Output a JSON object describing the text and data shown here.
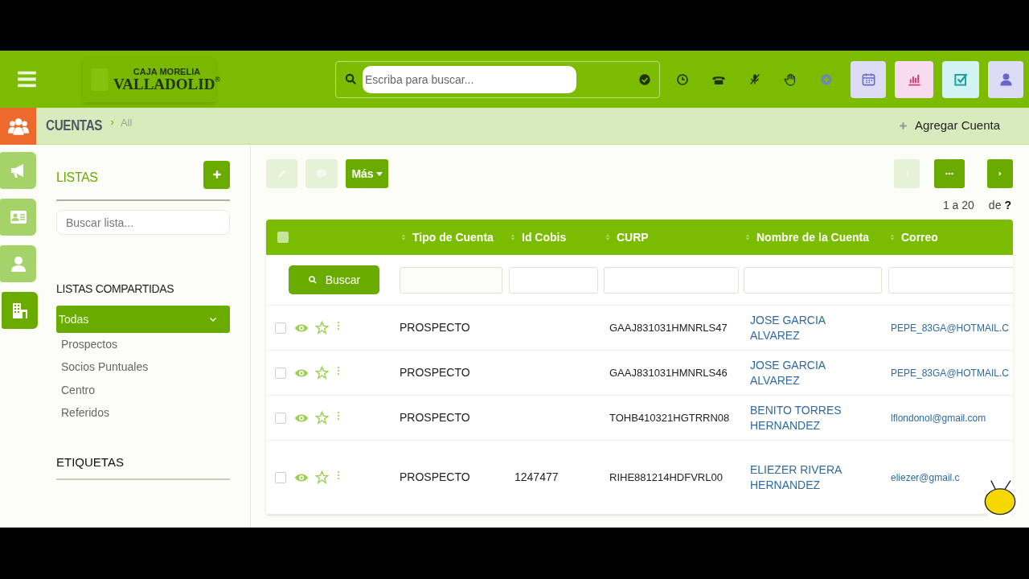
{
  "header": {
    "logo": {
      "line1": "CAJA MORELIA",
      "line2": "VALLADOLID",
      "mark": "®"
    },
    "search": {
      "placeholder": "Escriba para buscar..."
    }
  },
  "page_bar": {
    "title": "CUENTAS",
    "crumb_separator": "›",
    "crumb": "All",
    "add_button": "Agregar Cuenta"
  },
  "rail": [
    {
      "kind": "megaphone",
      "selected": false
    },
    {
      "kind": "card",
      "selected": false
    },
    {
      "kind": "person",
      "selected": false
    },
    {
      "kind": "building",
      "selected": true
    }
  ],
  "sidebar": {
    "lists_title": "LISTAS",
    "search_placeholder": "Buscar lista...",
    "shared_title": "LISTAS COMPARTIDAS",
    "shared_items": [
      {
        "label": "Todas",
        "selected": true
      },
      {
        "label": "Prospectos",
        "selected": false
      },
      {
        "label": "Socios Puntuales",
        "selected": false
      },
      {
        "label": "Centro",
        "selected": false
      },
      {
        "label": "Referidos",
        "selected": false
      }
    ],
    "tags_title": "ETIQUETAS"
  },
  "toolbar": {
    "more_button": "Más",
    "range": "1 a 20",
    "of": "de",
    "total": "?"
  },
  "table": {
    "columns": [
      "Tipo de Cuenta",
      "Id Cobis",
      "CURP",
      "Nombre de la Cuenta",
      "Correo"
    ],
    "search_button": "Buscar",
    "select_all_checked": false,
    "rows": [
      {
        "checked": false,
        "tipo": "PROSPECTO",
        "curp": "GAAJ831031HMNRLS47",
        "nombre": "JOSE GARCIA ALVAREZ",
        "correo": "PEPE_83GA@HOTMAIL.C"
      },
      {
        "checked": false,
        "tipo": "PROSPECTO",
        "curp": "GAAJ831031HMNRLS46",
        "nombre": "JOSE GARCIA ALVAREZ",
        "correo": "PEPE_83GA@HOTMAIL.C"
      },
      {
        "checked": false,
        "tipo": "PROSPECTO",
        "curp": "TOHB410321HGTRRN08",
        "nombre": "BENITO TORRES HERNANDEZ",
        "correo": "lflondonol@gmail.com"
      },
      {
        "checked": false,
        "tipo": "PROSPECTO",
        "id_cobis": "1247477",
        "curp": "RIHE881214HDFVRL00",
        "nombre": "ELIEZER RIVERA HERNANDEZ",
        "correo": "eliezer@gmail.c"
      }
    ]
  }
}
